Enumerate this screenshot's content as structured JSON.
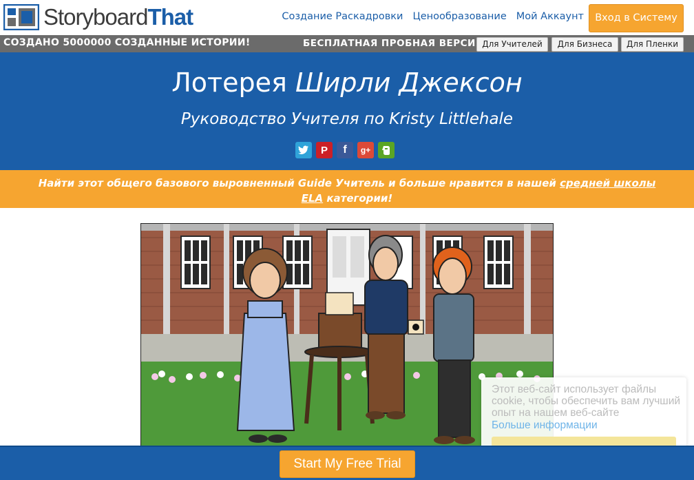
{
  "header": {
    "logo_part1": "Storyboard",
    "logo_part2": "That",
    "nav": [
      "Создание Раскадровки",
      "Ценообразование",
      "Мой Аккаунт"
    ],
    "login_label": "Вход в Систему"
  },
  "subbar": {
    "created_text": "СОЗДАНО 5000000 СОЗДАННЫЕ ИСТОРИИ!",
    "trial_text": "БЕСПЛАТНАЯ ПРОБНАЯ ВЕРСИЯ",
    "buttons": [
      "Для Учителей",
      "Для Бизнеса",
      "Для Пленки"
    ]
  },
  "hero": {
    "title_plain": "Лотерея ",
    "title_italic": "Ширли Джексон",
    "subtitle": "Руководство Учителя по Kristy Littlehale"
  },
  "social": [
    "twitter-icon",
    "pinterest-icon",
    "facebook-icon",
    "google-plus-icon",
    "evernote-icon"
  ],
  "promo": {
    "text_before": "Найти этот общего базового выровненный Guide Учитель и больше нравится в нашей ",
    "link": "средней школы ELA",
    "text_after": " категории!"
  },
  "cookie": {
    "text": "Этот веб-сайт использует файлы cookie, чтобы обеспечить вам лучший опыт на нашем веб-сайте",
    "link": "Больше информации"
  },
  "footer": {
    "trial_button": "Start My Free Trial"
  },
  "colors": {
    "brand_blue": "#1b5ea8",
    "accent_orange": "#f6a530",
    "bar_gray": "#6b6b6b"
  }
}
